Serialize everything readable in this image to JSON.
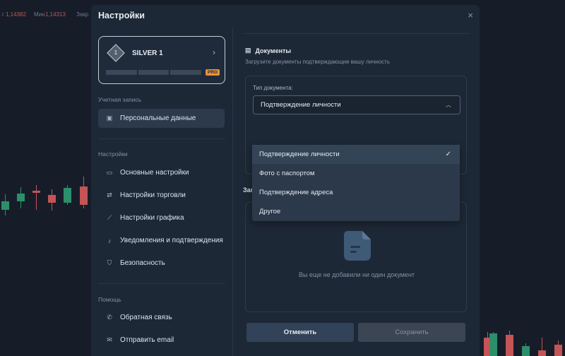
{
  "ticker": {
    "t1_label": "г",
    "t1_value": "1,14382",
    "t2_label": "Мин",
    "t2_value": "1,14313",
    "t3_label": "Закр"
  },
  "modal": {
    "title": "Настройки",
    "close": "×"
  },
  "level": {
    "number": "1",
    "name": "SILVER 1",
    "badge": "PRO",
    "progress_fraction": 0.0
  },
  "sidebar": {
    "account_label": "Учетная запись",
    "account_items": [
      {
        "label": "Персональные данные",
        "icon": "id-card-icon",
        "active": true
      }
    ],
    "settings_label": "Настройки",
    "settings_items": [
      {
        "label": "Основные настройки",
        "icon": "laptop-icon"
      },
      {
        "label": "Настройки торговли",
        "icon": "arrows-icon"
      },
      {
        "label": "Настройки графика",
        "icon": "chart-icon"
      },
      {
        "label": "Уведомления и подтверждения",
        "icon": "bell-icon"
      },
      {
        "label": "Безопасность",
        "icon": "shield-icon"
      }
    ],
    "help_label": "Помощь",
    "help_items": [
      {
        "label": "Обратная связь",
        "icon": "phone-icon"
      },
      {
        "label": "Отправить email",
        "icon": "mail-icon"
      }
    ]
  },
  "documents": {
    "title": "Документы",
    "subtitle": "Загрузите документы подтверждающие вашу личность",
    "type_label": "Тип документа:",
    "selected": "Подтверждение личности",
    "options": [
      "Подтверждение личности",
      "Фото с паспортом",
      "Подтверждение адреса",
      "Другое"
    ],
    "upload_label": "Заг",
    "empty_text": "Вы еще не добавили ни один документ"
  },
  "buttons": {
    "cancel": "Отменить",
    "save": "Сохранить"
  },
  "colors": {
    "bg": "#161d29",
    "modal": "#1d2836",
    "green": "#2c8f6a",
    "red": "#c45456",
    "pro": "#e9913c"
  }
}
